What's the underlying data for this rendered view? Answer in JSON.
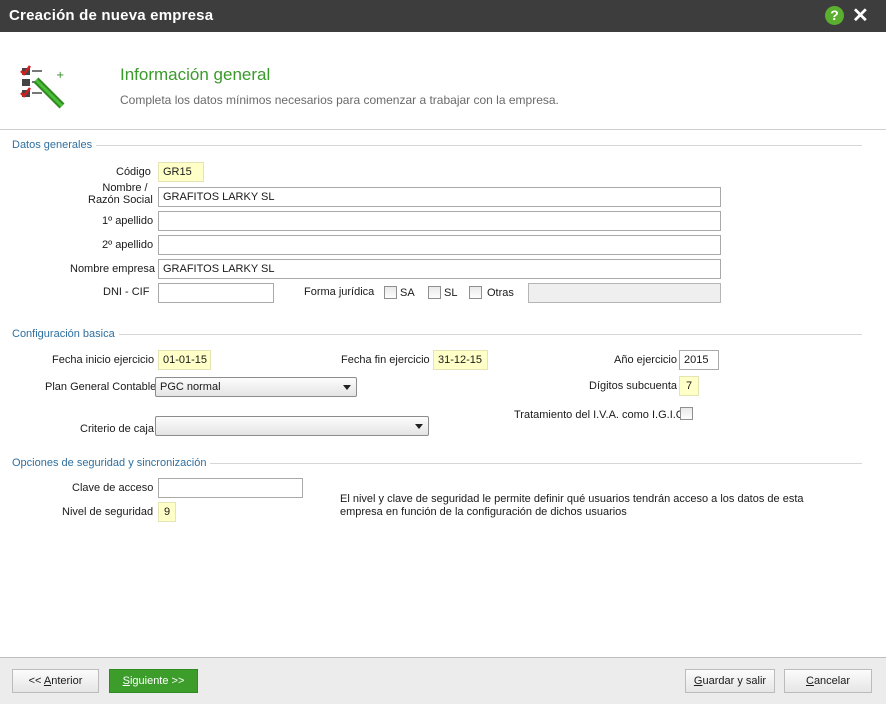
{
  "window": {
    "title": "Creación de nueva empresa",
    "help_icon": "question-icon",
    "close_icon": "close-icon",
    "titlebar_color": "#3d3d3d",
    "accent_color": "#3a9a2a"
  },
  "header": {
    "title": "Información general",
    "subtitle": "Completa los datos mínimos necesarios para comenzar a trabajar con la empresa."
  },
  "datos_generales": {
    "section_title": "Datos generales",
    "codigo_label": "Código",
    "codigo_value": "GR15",
    "nombre_label_1": "Nombre /",
    "nombre_label_2": "Razón Social",
    "nombre_value": "GRAFITOS LARKY SL",
    "apellido1_label": "1º apellido",
    "apellido1_value": "",
    "apellido2_label": "2º apellido",
    "apellido2_value": "",
    "nombre_empresa_label": "Nombre empresa",
    "nombre_empresa_value": "GRAFITOS LARKY SL",
    "dni_label": "DNI - CIF",
    "dni_value": "",
    "forma_label": "Forma jurídica",
    "forma_options": [
      "SA",
      "SL",
      "Otras"
    ],
    "forma_otras_value": ""
  },
  "configuracion": {
    "section_title": "Configuración basica",
    "fecha_inicio_label": "Fecha inicio ejercicio",
    "fecha_inicio_value": "01-01-15",
    "fecha_fin_label": "Fecha fin ejercicio",
    "fecha_fin_value": "31-12-15",
    "anio_label": "Año ejercicio",
    "anio_value": "2015",
    "plan_label": "Plan General Contable",
    "plan_value": "PGC normal",
    "digitos_label": "Dígitos subcuenta",
    "digitos_value": "7",
    "iva_label": "Tratamiento del I.V.A. como I.G.I.C.",
    "criterio_label": "Criterio de caja",
    "criterio_value": ""
  },
  "seguridad": {
    "section_title": "Opciones de seguridad y sincronización",
    "clave_label": "Clave de acceso",
    "clave_value": "",
    "nivel_label": "Nivel de seguridad",
    "nivel_value": "9",
    "info_line_1": "El nivel y clave de seguridad le permite definir qué usuarios tendrán acceso a los datos de esta",
    "info_line_2": "empresa en función de la configuración de dichos usuarios"
  },
  "footer": {
    "anterior_prefix": "<< ",
    "anterior_key": "A",
    "anterior_rest": "nterior",
    "siguiente_key": "S",
    "siguiente_rest": "iguiente >>",
    "guardar_key": "G",
    "guardar_rest": "uardar y salir",
    "cancelar_key": "C",
    "cancelar_rest": "ancelar"
  }
}
